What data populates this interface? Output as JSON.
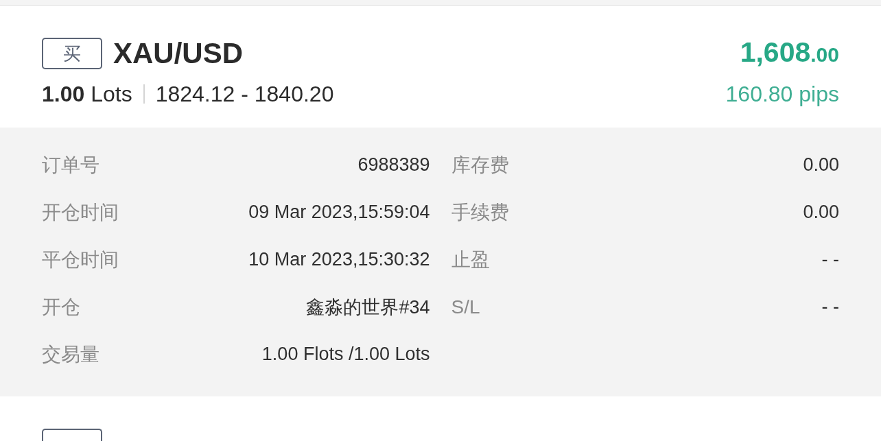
{
  "order": {
    "side": {
      "kind": "buy",
      "label": "买"
    },
    "symbol": "XAU/USD",
    "volume": "**1.00** Lots",
    "price_range": "1824.12 - 1840.20",
    "profit": {
      "profitable": true,
      "amount": "1,608",
      "decimals": ".00"
    },
    "pips": "160.80 pips",
    "details": [
      [
        {
          "label": "订单号",
          "value": "6988389"
        },
        {
          "label": "库存费",
          "value": "0.00"
        }
      ],
      [
        {
          "label": "开仓时间",
          "value": "09 Mar 2023,15:59:04"
        },
        {
          "label": "手续费",
          "value": "0.00"
        }
      ],
      [
        {
          "label": "平仓时间",
          "value": "10 Mar 2023,15:30:32"
        },
        {
          "label": "止盈",
          "value": "- -"
        }
      ],
      [
        {
          "label": "开仓",
          "value": "鑫淼的世界#34"
        },
        {
          "label": "S/L",
          "value": "- -"
        }
      ],
      [
        {
          "label": "交易量",
          "value": "1.00 Flots /1.00 Lots"
        }
      ]
    ]
  },
  "next_order": {
    "side": {
      "kind": "buy"
    }
  }
}
